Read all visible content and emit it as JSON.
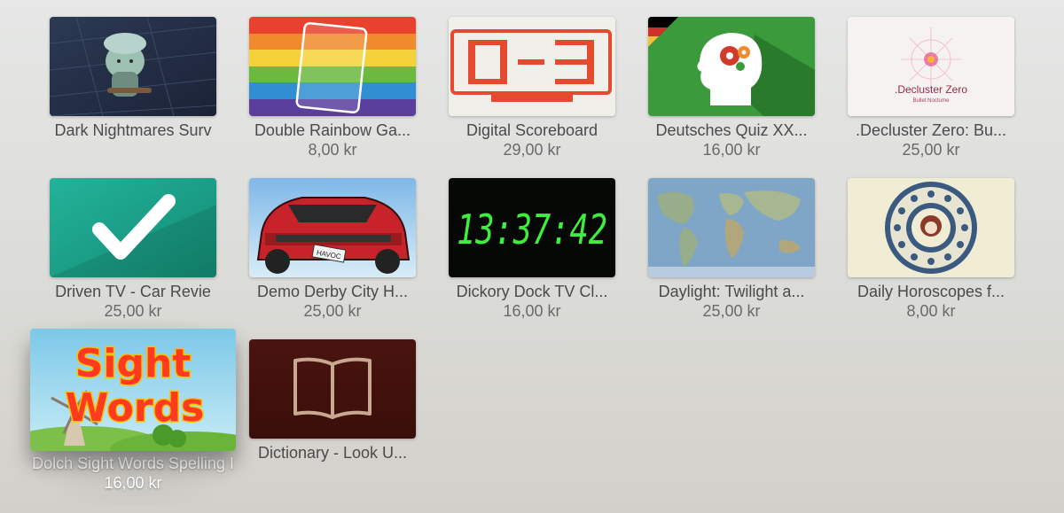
{
  "apps": [
    {
      "title": "Dark Nightmares Surv",
      "price": "",
      "icon": "dark-nightmares-art"
    },
    {
      "title": "Double Rainbow Ga...",
      "price": "8,00 kr",
      "icon": "rainbow-art"
    },
    {
      "title": "Digital Scoreboard",
      "price": "29,00 kr",
      "icon": "scoreboard-art"
    },
    {
      "title": "Deutsches Quiz XX...",
      "price": "16,00 kr",
      "icon": "quiz-head-art"
    },
    {
      "title": ".Decluster Zero: Bu...",
      "price": "25,00 kr",
      "icon": "decluster-art"
    },
    {
      "title": "Driven TV - Car Revie",
      "price": "25,00 kr",
      "icon": "checkmark-art"
    },
    {
      "title": "Demo Derby City H...",
      "price": "25,00 kr",
      "icon": "derby-car-art"
    },
    {
      "title": "Dickory Dock TV Cl...",
      "price": "16,00 kr",
      "icon": "digital-clock-art"
    },
    {
      "title": "Daylight: Twilight a...",
      "price": "25,00 kr",
      "icon": "world-map-art"
    },
    {
      "title": "Daily Horoscopes f...",
      "price": "8,00 kr",
      "icon": "zodiac-art"
    },
    {
      "title": "Dolch Sight Words Spelling I",
      "price": "16,00 kr",
      "icon": "sight-words-art"
    },
    {
      "title": "Dictionary - Look U...",
      "price": "",
      "icon": "book-art"
    }
  ],
  "art_text": {
    "scoreboard_digits": "0-3",
    "clock": "13:37:42",
    "decluster_logo": ".Decluster Zero",
    "decluster_sub": "Bullet Nocturne",
    "derby_plate": "HAVOC",
    "sight_line1": "Sight",
    "sight_line2": "Words"
  },
  "colors": {
    "rainbow": [
      "#e8422f",
      "#f08a2a",
      "#f5d23a",
      "#6bb93f",
      "#2f8fd2",
      "#5a3e9c"
    ],
    "quiz_green": "#3a9a3c",
    "check_teal": "#1aa08a",
    "clock_green": "#3cf03c",
    "dictionary_bg": "#4a1410"
  }
}
